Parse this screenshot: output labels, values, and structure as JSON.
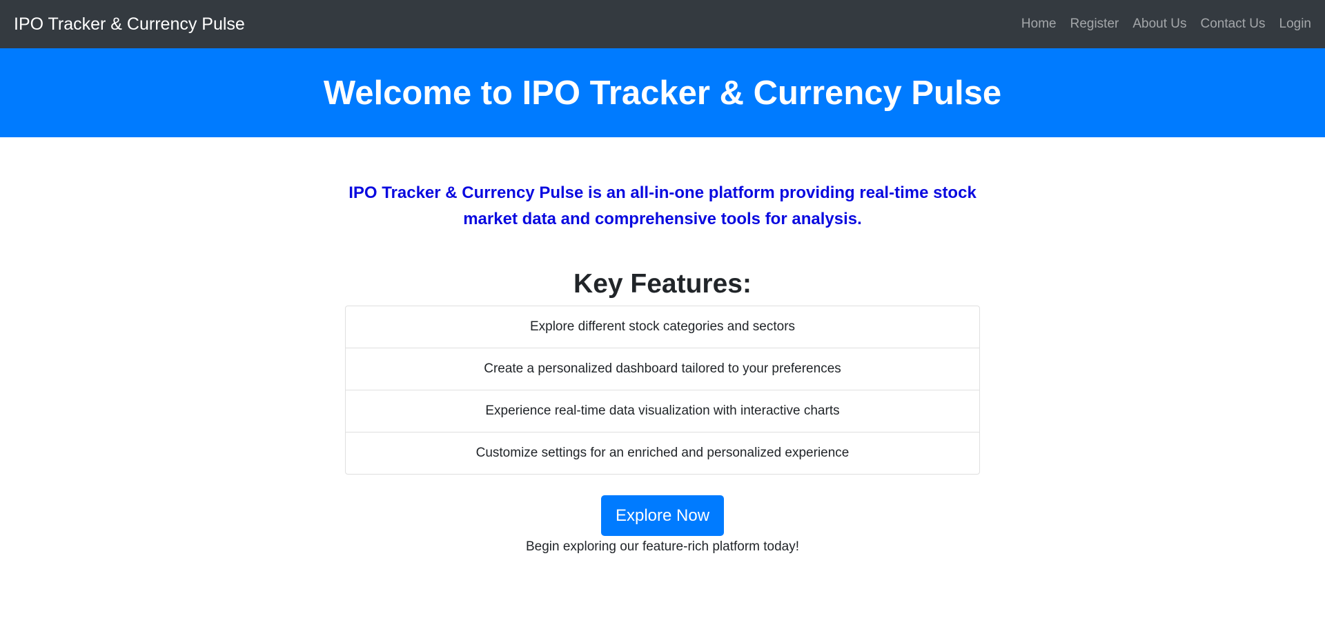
{
  "navbar": {
    "brand": "IPO Tracker & Currency Pulse",
    "links": [
      "Home",
      "Register",
      "About Us",
      "Contact Us",
      "Login"
    ]
  },
  "hero": {
    "title": "Welcome to IPO Tracker & Currency Pulse"
  },
  "main": {
    "intro": "IPO Tracker & Currency Pulse is an all-in-one platform providing real-time stock market data and comprehensive tools for analysis.",
    "features_title": "Key Features:",
    "features": [
      "Explore different stock categories and sectors",
      "Create a personalized dashboard tailored to your preferences",
      "Experience real-time data visualization with interactive charts",
      "Customize settings for an enriched and personalized experience"
    ],
    "cta_button": "Explore Now",
    "cta_subtext": "Begin exploring our feature-rich platform today!"
  },
  "colors": {
    "navbar_bg": "#343a40",
    "hero_bg": "#007bff",
    "intro_text": "#0a0adf",
    "button_bg": "#007bff"
  }
}
